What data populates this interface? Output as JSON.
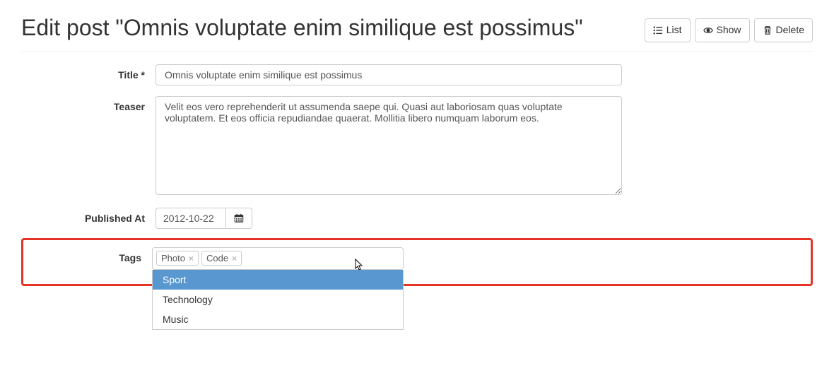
{
  "header": {
    "title": "Edit post \"Omnis voluptate enim similique est possimus\"",
    "actions": {
      "list": "List",
      "show": "Show",
      "delete": "Delete"
    }
  },
  "form": {
    "title": {
      "label": "Title *",
      "value": "Omnis voluptate enim similique est possimus"
    },
    "teaser": {
      "label": "Teaser",
      "value": "Velit eos vero reprehenderit ut assumenda saepe qui. Quasi aut laboriosam quas voluptate voluptatem. Et eos officia repudiandae quaerat. Mollitia libero numquam laborum eos."
    },
    "published_at": {
      "label": "Published At",
      "value": "2012-10-22"
    },
    "tags": {
      "label": "Tags",
      "selected": [
        "Photo",
        "Code"
      ],
      "options": [
        "Sport",
        "Technology",
        "Music"
      ],
      "highlighted_option_index": 0
    }
  }
}
